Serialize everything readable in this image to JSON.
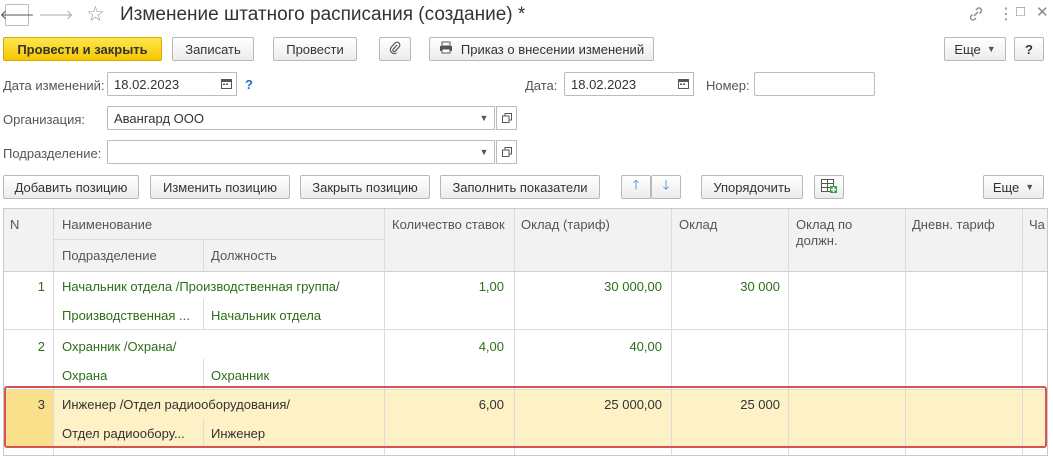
{
  "window": {
    "title": "Изменение штатного расписания (создание) *"
  },
  "icons": {
    "back": "arrow-left-icon",
    "forward": "arrow-right-icon",
    "favorite": "star-icon",
    "link": "link-icon",
    "menu": "more-icon",
    "maximize": "maximize-icon",
    "close": "close-icon",
    "attach": "paperclip-icon",
    "print": "printer-icon",
    "calendar": "calendar-icon",
    "up": "arrow-up-icon",
    "down": "arrow-down-icon",
    "table_settings": "table-settings-icon"
  },
  "toolbar": {
    "post_close": "Провести и закрыть",
    "save": "Записать",
    "post": "Провести",
    "print_order": "Приказ о внесении изменений",
    "more": "Еще",
    "help": "?"
  },
  "form": {
    "change_date_label": "Дата изменений:",
    "change_date": "18.02.2023",
    "help_mark": "?",
    "date_label": "Дата:",
    "date": "18.02.2023",
    "number_label": "Номер:",
    "number": "",
    "org_label": "Организация:",
    "org": "Авангард ООО",
    "dept_label": "Подразделение:",
    "dept": ""
  },
  "table_toolbar": {
    "add": "Добавить позицию",
    "edit": "Изменить позицию",
    "close": "Закрыть позицию",
    "fill": "Заполнить показатели",
    "sort": "Упорядочить",
    "more": "Еще"
  },
  "table": {
    "headers": {
      "n": "N",
      "name": "Наименование",
      "dept": "Подразделение",
      "position": "Должность",
      "rates": "Количество ставок",
      "tariff": "Оклад (тариф)",
      "salary": "Оклад",
      "salary_pos_1": "Оклад по",
      "salary_pos_2": "должн.",
      "day_tariff": "Дневн. тариф",
      "extra": "Ча"
    },
    "rows": [
      {
        "n": "1",
        "name": "Начальник отдела /Производственная группа/",
        "dept": "Производственная ...",
        "position": "Начальник отдела",
        "rates": "1,00",
        "tariff": "30 000,00",
        "salary": "30 000"
      },
      {
        "n": "2",
        "name": "Охранник /Охрана/",
        "dept": "Охрана",
        "position": "Охранник",
        "rates": "4,00",
        "tariff": "40,00",
        "salary": ""
      },
      {
        "n": "3",
        "name": "Инженер /Отдел радиооборудования/",
        "dept": "Отдел радиообору...",
        "position": "Инженер",
        "rates": "6,00",
        "tariff": "25 000,00",
        "salary": "25 000"
      }
    ]
  },
  "colors": {
    "primary_button": "#f5c800",
    "selected_row": "#fdf1c5",
    "selection_outline": "#d9534f",
    "row_text_green": "#2b6f19"
  }
}
